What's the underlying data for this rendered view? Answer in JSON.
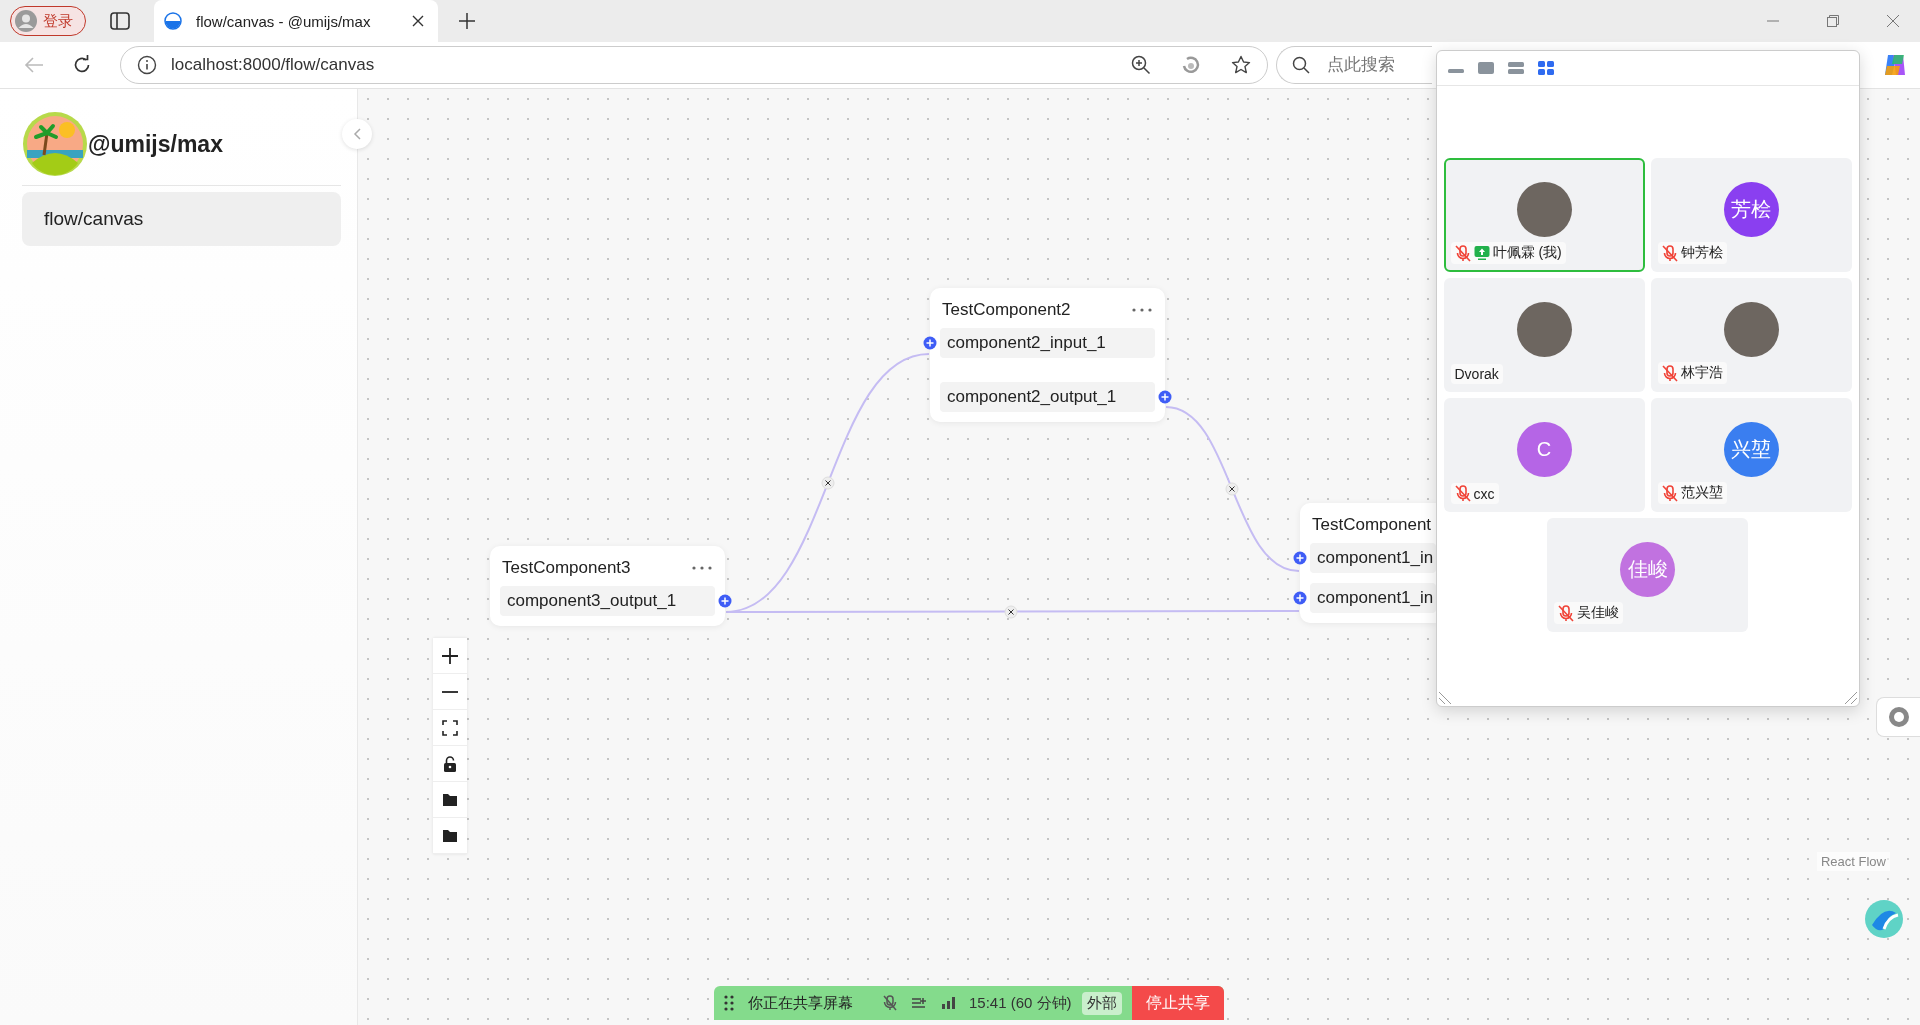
{
  "browser": {
    "profile_button": "登录",
    "tabs": [
      {
        "title": "flow/canvas - @umijs/max",
        "selected": true
      }
    ],
    "address": "localhost:8000/flow/canvas",
    "search": {
      "placeholder": "点此搜索"
    }
  },
  "sidebar": {
    "title": "@umijs/max",
    "items": [
      {
        "label": "flow/canvas",
        "selected": true
      }
    ]
  },
  "canvas": {
    "nodes": [
      {
        "title": "TestComponent2",
        "ports": [
          {
            "label": "component2_input_1",
            "kind": "input"
          },
          {
            "label": "component2_output_1",
            "kind": "output"
          }
        ]
      },
      {
        "title": "TestComponent3",
        "ports": [
          {
            "label": "component3_output_1",
            "kind": "output"
          }
        ]
      },
      {
        "title": "TestComponent",
        "ports": [
          {
            "label": "component1_in",
            "kind": "input"
          },
          {
            "label": "component1_in",
            "kind": "input"
          }
        ]
      }
    ],
    "attribution": "React Flow"
  },
  "meeting_panel": {
    "views": [
      {
        "kind": "minimize",
        "selected": false
      },
      {
        "kind": "single",
        "selected": false
      },
      {
        "kind": "split",
        "selected": false
      },
      {
        "kind": "grid",
        "selected": true
      }
    ],
    "participants": [
      {
        "name": "叶佩霖 (我)",
        "kind": "photo",
        "muted": true,
        "sharing": true,
        "active": true
      },
      {
        "name": "钟芳桧",
        "kind": "initials",
        "avatar_text": "芳桧",
        "color": "#8a3ff0",
        "muted": true,
        "sharing": false,
        "active": false
      },
      {
        "name": "Dvorak",
        "kind": "photo",
        "muted": false,
        "sharing": false,
        "active": false
      },
      {
        "name": "林宇浩",
        "kind": "photo",
        "muted": true,
        "sharing": false,
        "active": false
      },
      {
        "name": "cxc",
        "kind": "initials",
        "avatar_text": "C",
        "color": "#b565e6",
        "muted": true,
        "sharing": false,
        "active": false
      },
      {
        "name": "范兴堃",
        "kind": "initials",
        "avatar_text": "兴堃",
        "color": "#3a7ef0",
        "muted": true,
        "sharing": false,
        "active": false
      },
      {
        "name": "吴佳峻",
        "kind": "initials",
        "avatar_text": "佳峻",
        "color": "#c172e0",
        "muted": true,
        "sharing": false,
        "active": false
      }
    ]
  },
  "share_bar": {
    "status": "你正在共享屏幕",
    "time": "15:41 (60 分钟)",
    "tag": "外部",
    "stop_button": "停止共享"
  }
}
